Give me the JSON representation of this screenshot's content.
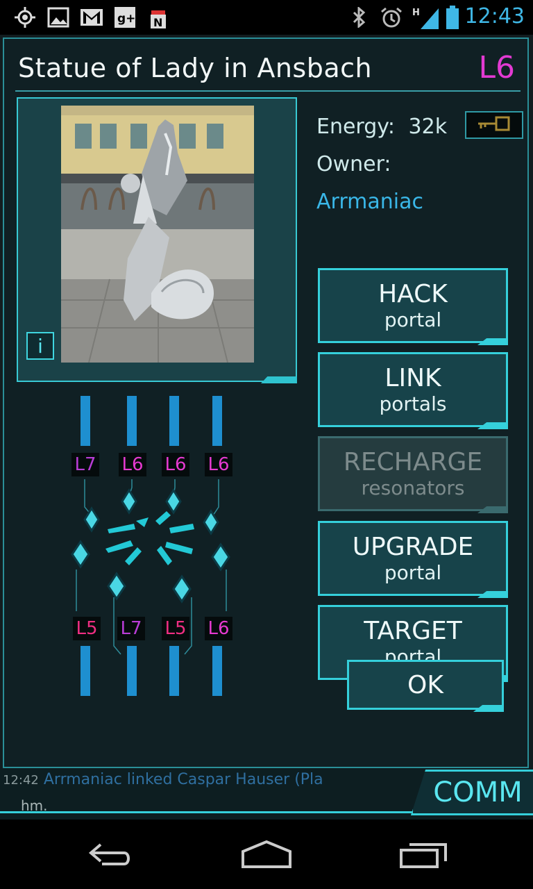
{
  "status_bar": {
    "time": "12:43",
    "network_label": "H",
    "icons": [
      "gps-icon",
      "gallery-icon",
      "gmail-icon",
      "google-plus-icon",
      "ingress-icon",
      "bluetooth-icon",
      "alarm-icon",
      "signal-icon",
      "battery-icon"
    ]
  },
  "portal": {
    "title": "Statue of Lady in Ansbach",
    "level": "L6",
    "energy_label": "Energy:",
    "energy_value": "32k",
    "owner_label": "Owner:",
    "owner_name": "Arrmaniac",
    "info_label": "i"
  },
  "actions": [
    {
      "line1": "HACK",
      "line2": "portal",
      "enabled": true
    },
    {
      "line1": "LINK",
      "line2": "portals",
      "enabled": true
    },
    {
      "line1": "RECHARGE",
      "line2": "resonators",
      "enabled": false
    },
    {
      "line1": "UPGRADE",
      "line2": "portal",
      "enabled": true
    },
    {
      "line1": "TARGET",
      "line2": "portal",
      "enabled": true
    }
  ],
  "ok_label": "OK",
  "resonators": {
    "top": [
      "L7",
      "L6",
      "L6",
      "L6"
    ],
    "bottom": [
      "L5",
      "L7",
      "L5",
      "L6"
    ]
  },
  "comm": {
    "button_label": "COMM",
    "partial_time": "12:42",
    "partial_message": "Arrmaniac linked Caspar Hauser (Pla",
    "partial_line2": "hm."
  },
  "colors": {
    "accent": "#35d0db",
    "level_magenta": "#e23ad2",
    "owner_blue": "#3ab7e8"
  }
}
